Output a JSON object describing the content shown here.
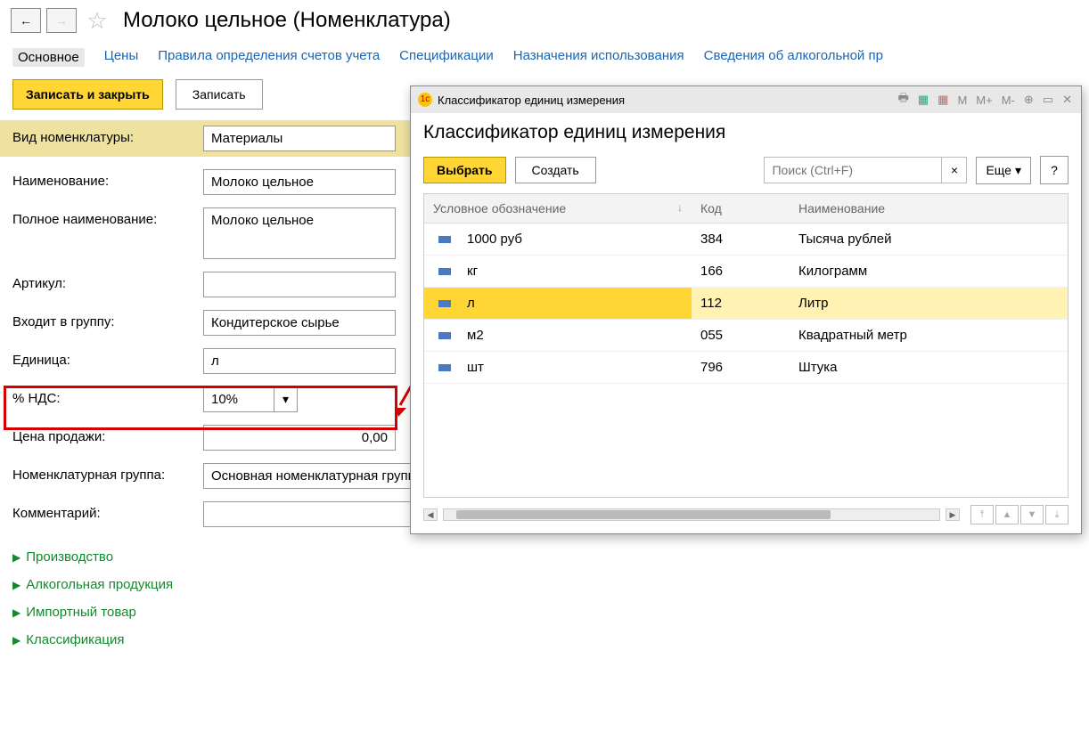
{
  "page_title": "Молоко цельное (Номенклатура)",
  "tabs": {
    "main": "Основное",
    "prices": "Цены",
    "rules": "Правила определения счетов учета",
    "specs": "Спецификации",
    "usage": "Назначения использования",
    "alcohol": "Сведения об алкогольной пр"
  },
  "toolbar": {
    "save_close": "Записать и закрыть",
    "save": "Записать"
  },
  "form": {
    "labels": {
      "type": "Вид номенклатуры:",
      "name": "Наименование:",
      "full_name": "Полное наименование:",
      "article": "Артикул:",
      "group": "Входит в группу:",
      "unit": "Единица:",
      "vat": "% НДС:",
      "price": "Цена продажи:",
      "nom_group": "Номенклатурная группа:",
      "comment": "Комментарий:"
    },
    "values": {
      "type": "Материалы",
      "name": "Молоко цельное",
      "full_name": "Молоко цельное",
      "article": "",
      "group": "Кондитерское сырье",
      "unit": "л",
      "vat": "10%",
      "price": "0,00",
      "nom_group": "Основная номенклатурная группа",
      "comment": ""
    }
  },
  "collapsibles": [
    "Производство",
    "Алкогольная продукция",
    "Импортный товар",
    "Классификация"
  ],
  "modal": {
    "window_title": "Классификатор единиц измерения",
    "header": "Классификатор единиц измерения",
    "toolbar": {
      "select": "Выбрать",
      "create": "Создать",
      "search_placeholder": "Поиск (Ctrl+F)",
      "more": "Еще",
      "help": "?"
    },
    "table": {
      "headers": {
        "symbol": "Условное обозначение",
        "code": "Код",
        "name": "Наименование"
      },
      "rows": [
        {
          "symbol": "1000 руб",
          "code": "384",
          "name": "Тысяча рублей",
          "selected": false
        },
        {
          "symbol": "кг",
          "code": "166",
          "name": "Килограмм",
          "selected": false
        },
        {
          "symbol": "л",
          "code": "112",
          "name": "Литр",
          "selected": true
        },
        {
          "symbol": "м2",
          "code": "055",
          "name": "Квадратный метр",
          "selected": false
        },
        {
          "symbol": "шт",
          "code": "796",
          "name": "Штука",
          "selected": false
        }
      ]
    }
  }
}
